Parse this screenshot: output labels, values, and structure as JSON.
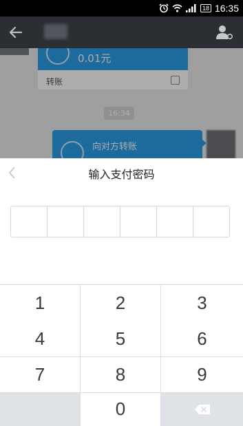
{
  "status_bar": {
    "time": "16:35",
    "battery": "18",
    "icons": [
      "alarm-icon",
      "wifi-icon",
      "signal-icon",
      "battery-icon"
    ]
  },
  "header": {
    "back_icon": "back-arrow-icon",
    "profile_icon": "profile-icon"
  },
  "chat": {
    "messages": [
      {
        "amount": "0.01元",
        "footer": "转账"
      },
      {
        "title": "向对方转账"
      }
    ],
    "time_badge": "16:34"
  },
  "dialog": {
    "title": "输入支付密码",
    "back_icon": "chevron-left-icon",
    "pin_length": 6
  },
  "keypad": {
    "keys": [
      "1",
      "2",
      "3",
      "4",
      "5",
      "6",
      "7",
      "8",
      "9",
      "0"
    ],
    "delete_icon": "backspace-icon"
  },
  "colors": {
    "accent": "#2b9de8",
    "header_bg": "#2b2e33",
    "keypad_special_bg": "#dfe2e6"
  }
}
